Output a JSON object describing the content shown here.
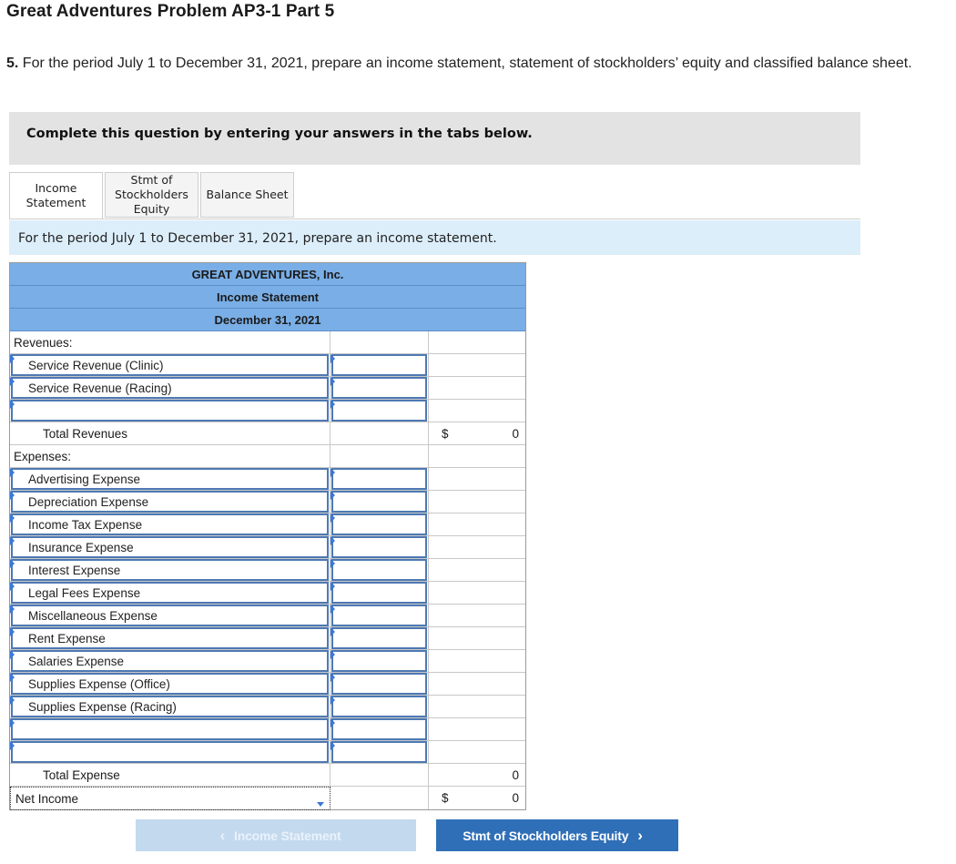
{
  "page": {
    "title": "Great Adventures Problem AP3-1 Part 5",
    "question_number": "5.",
    "question_text": "For the period July 1 to December 31, 2021, prepare an income statement, statement of stockholders’ equity and classified balance sheet."
  },
  "instruction": "Complete this question by entering your answers in the tabs below.",
  "tabs": [
    {
      "line1": "Income",
      "line2": "Statement",
      "line3": "",
      "active": true
    },
    {
      "line1": "Stmt of",
      "line2": "Stockholders",
      "line3": "Equity",
      "active": false
    },
    {
      "line1": "Balance Sheet",
      "line2": "",
      "line3": "",
      "active": false
    }
  ],
  "prompt": "For the period July 1 to December 31, 2021, prepare an income statement.",
  "statement": {
    "company": "GREAT ADVENTURES, Inc.",
    "name": "Income Statement",
    "date": "December 31, 2021",
    "revenues_label": "Revenues:",
    "revenue_items": [
      "Service Revenue (Clinic)",
      "Service Revenue (Racing)",
      ""
    ],
    "total_revenues_label": "Total Revenues",
    "total_revenues_currency": "$",
    "total_revenues_value": "0",
    "expenses_label": "Expenses:",
    "expense_items": [
      "Advertising Expense",
      "Depreciation Expense",
      "Income Tax Expense",
      "Insurance Expense",
      "Interest Expense",
      "Legal Fees Expense",
      "Miscellaneous Expense",
      "Rent Expense",
      "Salaries Expense",
      "Supplies Expense (Office)",
      "Supplies Expense (Racing)",
      "",
      ""
    ],
    "total_expense_label": "Total Expense",
    "total_expense_value": "0",
    "net_income_label": "Net Income",
    "net_income_currency": "$",
    "net_income_value": "0"
  },
  "nav": {
    "prev_label": "Income Statement",
    "next_label": "Stmt of Stockholders Equity"
  },
  "colors": {
    "header_blue": "#7aaee6",
    "input_border": "#4e79b3",
    "prompt_bg": "#dceefa",
    "next_button": "#2f6fb7",
    "prev_button_disabled": "#c3d9ee"
  }
}
